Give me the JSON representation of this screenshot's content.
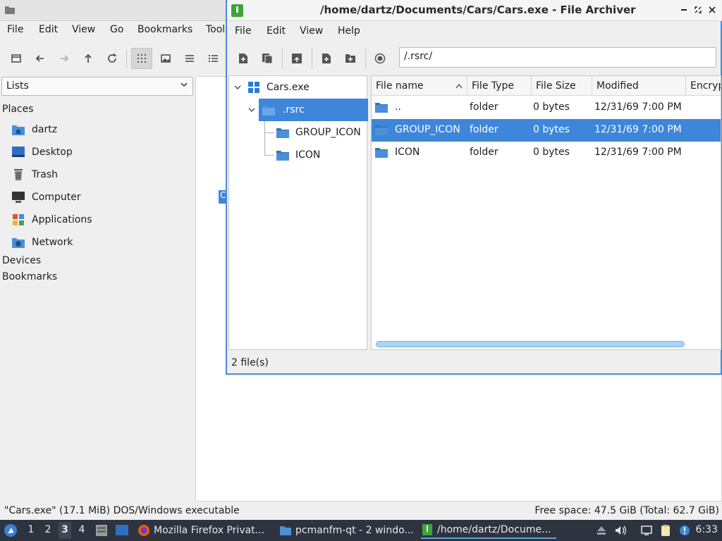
{
  "file_manager": {
    "menu": [
      "File",
      "Edit",
      "View",
      "Go",
      "Bookmarks",
      "Tool"
    ],
    "view_combo": "Lists",
    "sidebar": {
      "places_heading": "Places",
      "places": [
        {
          "label": "dartz",
          "icon": "home-folder-icon"
        },
        {
          "label": "Desktop",
          "icon": "desktop-icon"
        },
        {
          "label": "Trash",
          "icon": "trash-icon"
        },
        {
          "label": "Computer",
          "icon": "computer-icon"
        },
        {
          "label": "Applications",
          "icon": "applications-icon"
        },
        {
          "label": "Network",
          "icon": "network-icon"
        }
      ],
      "devices_heading": "Devices",
      "bookmarks_heading": "Bookmarks"
    },
    "view_fragment": "C",
    "status_left": "\"Cars.exe\" (17.1 MiB) DOS/Windows executable",
    "status_right": "Free space: 47.5 GiB (Total: 62.7 GiB)"
  },
  "archiver": {
    "title": "/home/dartz/Documents/Cars/Cars.exe - File Archiver",
    "menu": [
      "File",
      "Edit",
      "View",
      "Help"
    ],
    "path": "/.rsrc/",
    "tree": {
      "root": "Cars.exe",
      "selected": ".rsrc",
      "children": [
        "GROUP_ICON",
        "ICON"
      ]
    },
    "columns": [
      "File name",
      "File Type",
      "File Size",
      "Modified",
      "Encryp"
    ],
    "rows": [
      {
        "name": "..",
        "type": "folder",
        "size": "0 bytes",
        "modified": "12/31/69 7:00 PM",
        "selected": false
      },
      {
        "name": "GROUP_ICON",
        "type": "folder",
        "size": "0 bytes",
        "modified": "12/31/69 7:00 PM",
        "selected": true
      },
      {
        "name": "ICON",
        "type": "folder",
        "size": "0 bytes",
        "modified": "12/31/69 7:00 PM",
        "selected": false
      }
    ],
    "status": "2 file(s)"
  },
  "taskbar": {
    "workspaces": [
      "1",
      "2",
      "3",
      "4"
    ],
    "active_workspace": "3",
    "tasks": [
      {
        "label": "Mozilla Firefox Privat...",
        "icon": "firefox-icon"
      },
      {
        "label": "pcmanfm-qt - 2 windo...",
        "icon": "folder-icon"
      },
      {
        "label": "/home/dartz/Docume...",
        "icon": "archiver-icon"
      }
    ],
    "clock": "6:33"
  },
  "colors": {
    "accent": "#3d86d9",
    "folder": "#4a8fd8",
    "taskbar": "#2d3440"
  }
}
